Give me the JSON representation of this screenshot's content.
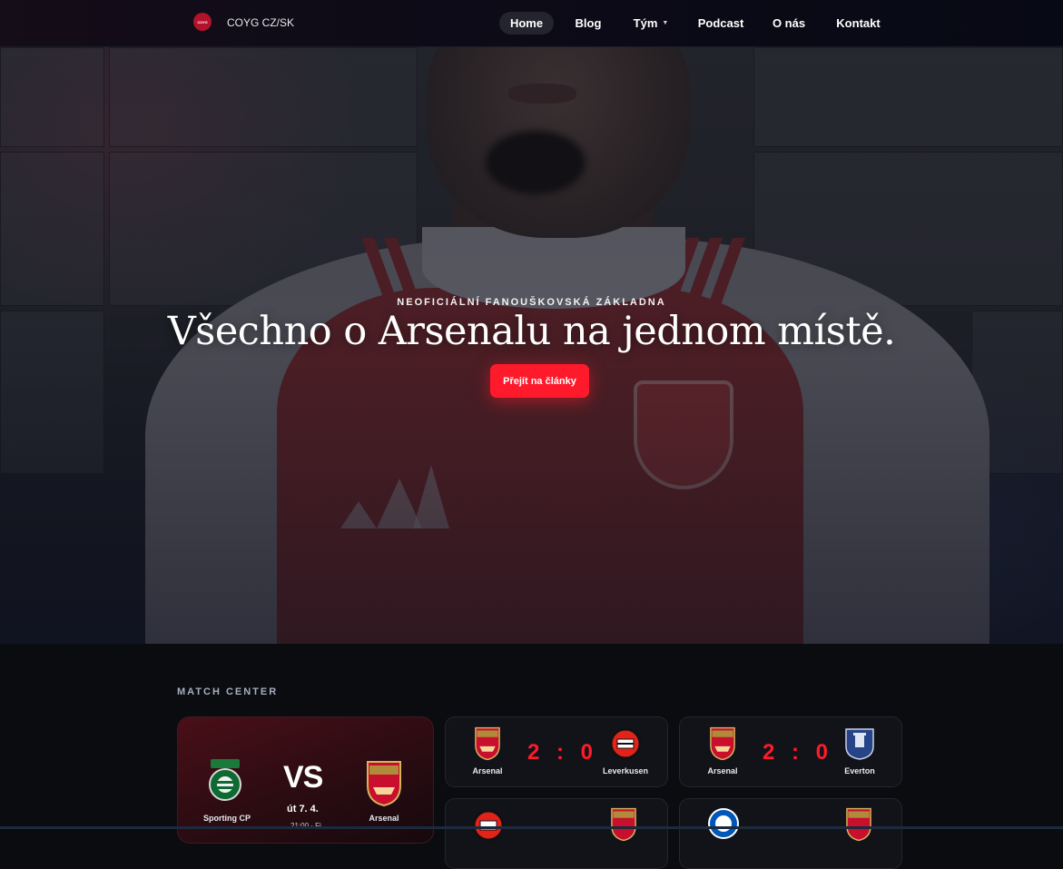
{
  "nav": {
    "logo_text": "COYG",
    "brand": "COYG CZ/SK",
    "items": [
      {
        "label": "Home",
        "active": true
      },
      {
        "label": "Blog"
      },
      {
        "label": "Tým",
        "has_dropdown": true
      },
      {
        "label": "Podcast"
      },
      {
        "label": "O nás"
      },
      {
        "label": "Kontakt"
      }
    ]
  },
  "hero": {
    "tagline": "NEOFICIÁLNÍ FANOUŠKOVSKÁ ZÁKLADNA",
    "headline": "Všechno o Arsenalu na jednom místě.",
    "cta": "Přejít na články",
    "accent": "#ff1a2b"
  },
  "match_center": {
    "title": "MATCH CENTER",
    "next_match": {
      "home": "Sporting CP",
      "away": "Arsenal",
      "vs": "VS",
      "date": "út 7. 4.",
      "time": "21:00 · Fi"
    },
    "results": [
      {
        "home": "Arsenal",
        "away": "Leverkusen",
        "score": "2 : 0"
      },
      {
        "home": "Arsenal",
        "away": "Everton",
        "score": "2 : 0"
      }
    ]
  }
}
